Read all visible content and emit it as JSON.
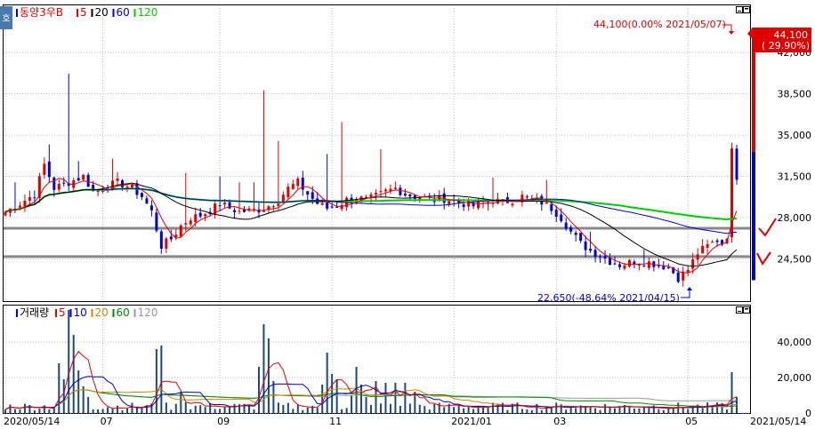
{
  "window": {
    "corner_label": "호",
    "price_panel": {
      "title": "동양3우B",
      "ma_legend": [
        {
          "label": "5",
          "color": "#e00000"
        },
        {
          "label": "20",
          "color": "#000000"
        },
        {
          "label": "60",
          "color": "#0000cc"
        },
        {
          "label": "120",
          "color": "#00cc00"
        }
      ]
    },
    "volume_panel": {
      "title": "거래량",
      "ma_legend": [
        {
          "label": "5",
          "color": "#e00000"
        },
        {
          "label": "10",
          "color": "#0000cc"
        },
        {
          "label": "20",
          "color": "#cc8800"
        },
        {
          "label": "60",
          "color": "#008800"
        },
        {
          "label": "120",
          "color": "#999999"
        }
      ]
    },
    "icons": [
      "minimize-icon",
      "maximize-icon"
    ]
  },
  "chart_data": [
    {
      "type": "candlestick",
      "yticks": [
        "42,000",
        "38,500",
        "35,000",
        "31,500",
        "28,000",
        "24,500"
      ],
      "ylim": [
        21000,
        46000
      ],
      "xticks": [
        "2020/05/14",
        "07",
        "09",
        "11",
        "2021/01",
        "03",
        "05"
      ],
      "last_date_label": "2021/05/14",
      "current_price": {
        "price": "44,100",
        "change": "( 29.90%)"
      },
      "max_annotation": "44,100(0.00% 2021/05/07)",
      "min_annotation": "22,650(-48.64% 2021/04/15)",
      "support_lines": [
        27100,
        24700
      ],
      "colors": {
        "up": "#e00000",
        "down": "#0000dd",
        "ma5": "#e00000",
        "ma20": "#000000",
        "ma60": "#0000cc",
        "ma120": "#00cc00",
        "support": "#888888"
      },
      "anchors": [
        [
          0,
          28500
        ],
        [
          3,
          29200
        ],
        [
          6,
          30000
        ],
        [
          8,
          32500
        ],
        [
          10,
          30500
        ],
        [
          13,
          31000
        ],
        [
          16,
          31500
        ],
        [
          18,
          30200
        ],
        [
          20,
          30500
        ],
        [
          23,
          31000
        ],
        [
          26,
          30500
        ],
        [
          28,
          29800
        ],
        [
          30,
          28500
        ],
        [
          32,
          25600
        ],
        [
          34,
          26200
        ],
        [
          36,
          27300
        ],
        [
          38,
          28000
        ],
        [
          40,
          28200
        ],
        [
          42,
          28600
        ],
        [
          44,
          29200
        ],
        [
          46,
          28800
        ],
        [
          48,
          28500
        ],
        [
          50,
          28600
        ],
        [
          52,
          28700
        ],
        [
          54,
          29000
        ],
        [
          56,
          29500
        ],
        [
          58,
          30500
        ],
        [
          60,
          31000
        ],
        [
          62,
          30000
        ],
        [
          64,
          29200
        ],
        [
          66,
          28800
        ],
        [
          68,
          29000
        ],
        [
          70,
          29500
        ],
        [
          72,
          29700
        ],
        [
          74,
          29500
        ],
        [
          76,
          29800
        ],
        [
          78,
          30200
        ],
        [
          80,
          30500
        ],
        [
          82,
          30000
        ],
        [
          84,
          29800
        ],
        [
          86,
          29700
        ],
        [
          88,
          29500
        ],
        [
          90,
          29600
        ],
        [
          92,
          29400
        ],
        [
          94,
          29200
        ],
        [
          96,
          29000
        ],
        [
          98,
          29200
        ],
        [
          100,
          29500
        ],
        [
          102,
          29300
        ],
        [
          104,
          29500
        ],
        [
          106,
          29800
        ],
        [
          108,
          29500
        ],
        [
          110,
          29300
        ],
        [
          112,
          28800
        ],
        [
          114,
          28000
        ],
        [
          116,
          26800
        ],
        [
          118,
          25800
        ],
        [
          120,
          25200
        ],
        [
          122,
          24800
        ],
        [
          124,
          24300
        ],
        [
          126,
          24000
        ],
        [
          128,
          24200
        ],
        [
          130,
          24300
        ],
        [
          132,
          24200
        ],
        [
          134,
          24000
        ],
        [
          136,
          23800
        ],
        [
          138,
          22900
        ],
        [
          140,
          23600
        ],
        [
          142,
          25000
        ],
        [
          144,
          25600
        ],
        [
          146,
          26100
        ],
        [
          147,
          25800
        ],
        [
          148,
          26500
        ],
        [
          149,
          33600
        ],
        [
          150,
          31500
        ]
      ],
      "spikes": [
        [
          2,
          31000
        ],
        [
          9,
          34200
        ],
        [
          13,
          40200
        ],
        [
          15,
          32800
        ],
        [
          22,
          33000
        ],
        [
          37,
          31800
        ],
        [
          44,
          31500
        ],
        [
          48,
          31000
        ],
        [
          51,
          31000
        ],
        [
          53,
          38800
        ],
        [
          56,
          34500
        ],
        [
          66,
          33400
        ],
        [
          69,
          36100
        ],
        [
          77,
          33800
        ],
        [
          100,
          31400
        ],
        [
          111,
          31200
        ],
        [
          120,
          26800
        ],
        [
          131,
          25300
        ],
        [
          149,
          33600
        ]
      ]
    },
    {
      "type": "bar",
      "yticks": [
        "40,000",
        "20,000",
        "0"
      ],
      "ylim": [
        0,
        60000
      ],
      "spikes": [
        [
          11,
          28000
        ],
        [
          12,
          19000
        ],
        [
          13,
          58000
        ],
        [
          14,
          44000
        ],
        [
          15,
          24000
        ],
        [
          16,
          15000
        ],
        [
          17,
          9000
        ],
        [
          31,
          36000
        ],
        [
          32,
          38000
        ],
        [
          36,
          12000
        ],
        [
          37,
          6000
        ],
        [
          52,
          26000
        ],
        [
          53,
          50000
        ],
        [
          54,
          42000
        ],
        [
          55,
          18000
        ],
        [
          65,
          16000
        ],
        [
          66,
          34000
        ],
        [
          67,
          22000
        ],
        [
          68,
          19000
        ],
        [
          71,
          10000
        ],
        [
          72,
          26000
        ],
        [
          73,
          16000
        ],
        [
          74,
          9000
        ],
        [
          76,
          18000
        ],
        [
          78,
          17000
        ],
        [
          80,
          17000
        ],
        [
          82,
          17000
        ],
        [
          84,
          12000
        ],
        [
          149,
          23000
        ],
        [
          150,
          9000
        ]
      ],
      "colors": {
        "bar": "#1a4a7a",
        "ma5": "#e00000",
        "ma10": "#0000cc",
        "ma20": "#cc8800",
        "ma60": "#008800",
        "ma120": "#999999"
      }
    }
  ]
}
